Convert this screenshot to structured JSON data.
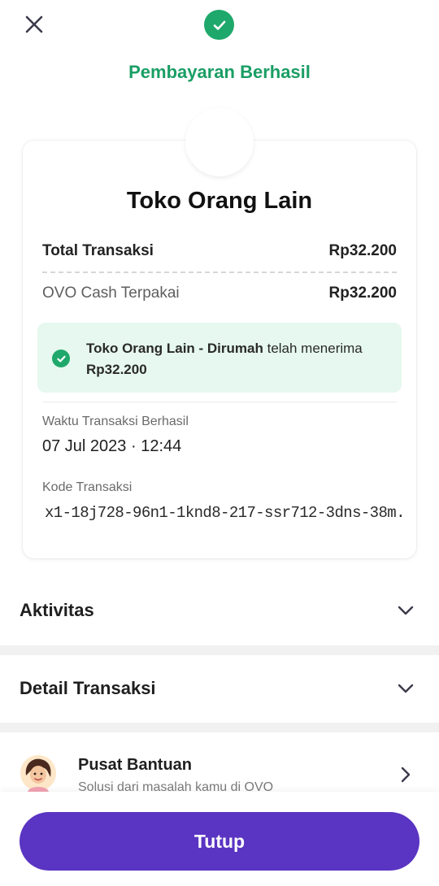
{
  "header": {
    "close_icon": "close-icon",
    "status_title": "Pembayaran Berhasil",
    "status_icon": "check-circle-icon"
  },
  "receipt": {
    "merchant_name": "Toko Orang Lain",
    "total_label": "Total Transaksi",
    "total_value": "Rp32.200",
    "ovo_label": "OVO Cash Terpakai",
    "ovo_value": "Rp32.200",
    "notice": {
      "merchant": "Toko Orang Lain - Dirumah",
      "text": " telah menerima",
      "amount": "Rp32.200"
    },
    "time_label": "Waktu Transaksi Berhasil",
    "time_value": "07 Jul 2023 · 12:44",
    "code_label": "Kode Transaksi",
    "code_value": "x1-18j728-96n1-1knd8-217-ssr712-3dns-38m.."
  },
  "sections": {
    "activity": "Aktivitas",
    "detail": "Detail Transaksi"
  },
  "help": {
    "title": "Pusat Bantuan",
    "subtitle": "Solusi dari masalah kamu di OVO"
  },
  "footer": {
    "close_button": "Tutup"
  },
  "colors": {
    "success": "#1fa86b",
    "success_bg": "#e6f8ef",
    "primary": "#5a34c2"
  }
}
